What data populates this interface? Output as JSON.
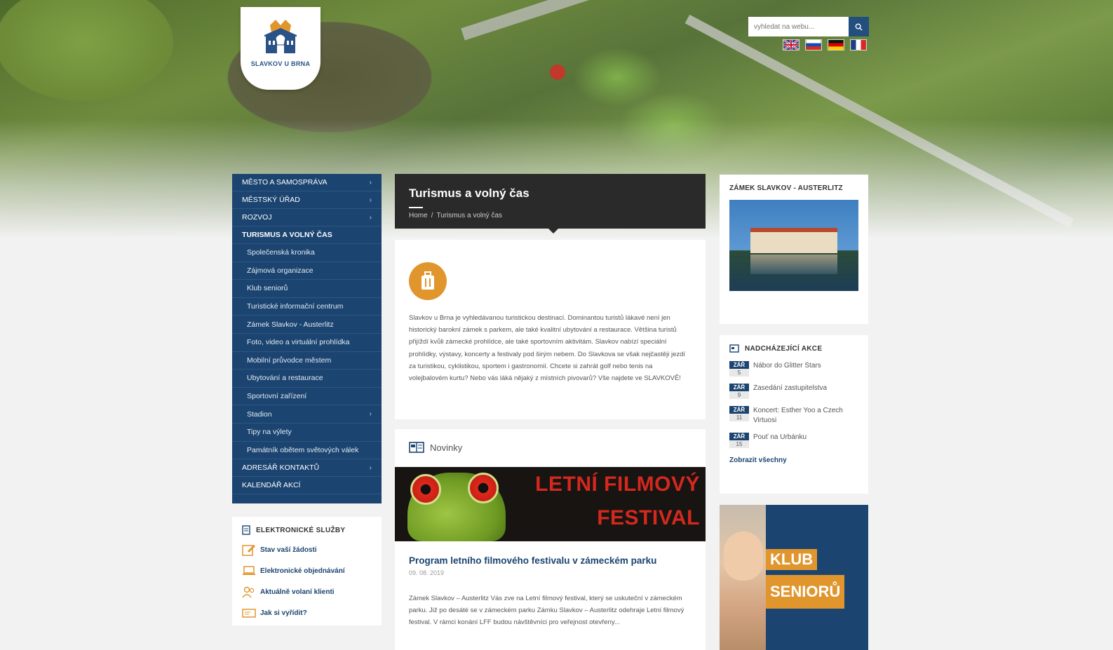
{
  "header": {
    "logo_text": "SLAVKOV U BRNA",
    "search_placeholder": "vyhledat na webu...",
    "flags": [
      "gb-flag",
      "ru-flag",
      "de-flag",
      "fr-flag"
    ]
  },
  "leftnav": {
    "items_top": [
      {
        "label": "Město a samospráva",
        "chevron": true
      },
      {
        "label": "Městský úřad",
        "chevron": true
      },
      {
        "label": "Rozvoj",
        "chevron": true
      }
    ],
    "active": "Turismus a volný čas",
    "subitems": [
      {
        "label": "Společenská kronika",
        "chevron": false
      },
      {
        "label": "Zájmová organizace",
        "chevron": false
      },
      {
        "label": "Klub seniorů",
        "chevron": false
      },
      {
        "label": "Turistické informační centrum",
        "chevron": false
      },
      {
        "label": "Zámek Slavkov - Austerlitz",
        "chevron": false
      },
      {
        "label": "Foto, video a virtuální prohlídka",
        "chevron": false
      },
      {
        "label": "Mobilní průvodce městem",
        "chevron": false
      },
      {
        "label": "Ubytování a restaurace",
        "chevron": false
      },
      {
        "label": "Sportovní zařízení",
        "chevron": false
      },
      {
        "label": "Stadion",
        "chevron": true
      },
      {
        "label": "Tipy na výlety",
        "chevron": false
      },
      {
        "label": "Památník obětem světových válek",
        "chevron": false
      }
    ],
    "items_bottom": [
      {
        "label": "Adresář kontaktů",
        "chevron": true
      },
      {
        "label": "Kalendář akcí",
        "chevron": false
      }
    ]
  },
  "eservices": {
    "title": "Elektronické služby",
    "items": [
      "Stav vaší žádosti",
      "Elektronické objednávání",
      "Aktuálně volaní klienti",
      "Jak si vyřídit?"
    ]
  },
  "page": {
    "title": "Turismus a volný čas",
    "breadcrumb_home": "Home",
    "breadcrumb_sep": "/",
    "breadcrumb_current": "Turismus a volný čas",
    "intro_text": "Slavkov u Brna je vyhledávanou turistickou destinací. Dominantou turistů lákavé není jen historický barokní zámek s parkem, ale také kvalitní ubytování a restaurace. Většina turistů přijíždí kvůli zámecké prohlídce, ale také sportovním aktivitám. Slavkov nabízí speciální prohlídky, výstavy, koncerty a festivaly pod širým nebem. Do Slavkova se však nejčastěji jezdí za turistikou, cyklistikou, sportem i gastronomií. Chcete si zahrát golf nebo tenis na volejbalovém kurtu? Nebo vás láká nějaký z místních pivovarů? Vše najdete ve SLAVKOVĚ!"
  },
  "news": {
    "section_title": "Novinky",
    "banner_line1": "LETNÍ FILMOVÝ",
    "banner_line2": "FESTIVAL",
    "headline": "Program letního filmového festivalu v zámeckém parku",
    "date": "09. 08. 2019",
    "text": "Zámek Slavkov – Austerlitz Vás zve na Letní filmový festival, který se uskuteční v zámeckém parku. Již po desáté se v zámeckém parku Zámku Slavkov – Austerlitz odehraje Letní filmový festival. V rámci konání LFF budou návštěvníci pro veřejnost otevřeny...",
    "news_icon": "newspaper-icon"
  },
  "right": {
    "castle_title": "Zámek Slavkov - Austerlitz",
    "events_title": "Nadcházející akce",
    "events": [
      {
        "month": "ZÁŘ",
        "day": "5",
        "name": "Nábor do Glitter Stars"
      },
      {
        "month": "ZÁŘ",
        "day": "9",
        "name": "Zasedání zastupitelstva"
      },
      {
        "month": "ZÁŘ",
        "day": "11",
        "name": "Koncert: Esther Yoo a Czech Virtuosi"
      },
      {
        "month": "ZÁŘ",
        "day": "15",
        "name": "Pouť na Urbánku"
      }
    ],
    "events_all": "Zobrazit všechny",
    "seniors_line1": "KLUB",
    "seniors_line2": "SENIORŮ"
  },
  "colors": {
    "navy": "#1b4470",
    "orange": "#e0962d",
    "dark_header": "#2a2a2a",
    "banner_red": "#d4281d"
  }
}
